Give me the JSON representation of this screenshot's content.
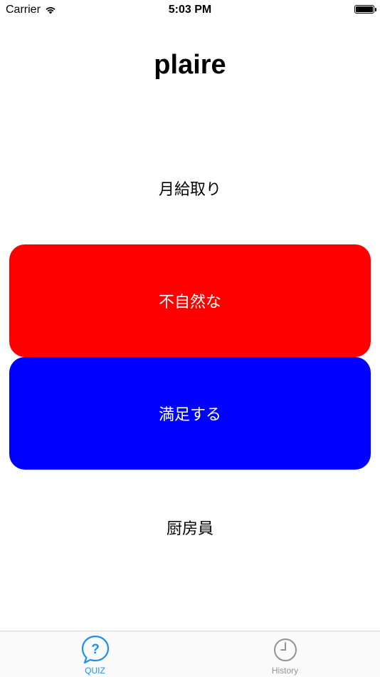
{
  "status_bar": {
    "carrier": "Carrier",
    "time": "5:03 PM",
    "battery_level": 1.0
  },
  "quiz": {
    "word": "plaire",
    "choices": [
      "月給取り",
      "不自然な",
      "満足する",
      "厨房員"
    ]
  },
  "tab_bar": {
    "tabs": [
      {
        "label": "QUIZ",
        "icon": "quiz-bubble-icon",
        "active": true
      },
      {
        "label": "History",
        "icon": "clock-icon",
        "active": false
      }
    ]
  },
  "colors": {
    "choice_red": "#ff0000",
    "choice_blue": "#0000ff",
    "tab_active": "#1e8ff0",
    "tab_inactive": "#929292"
  }
}
